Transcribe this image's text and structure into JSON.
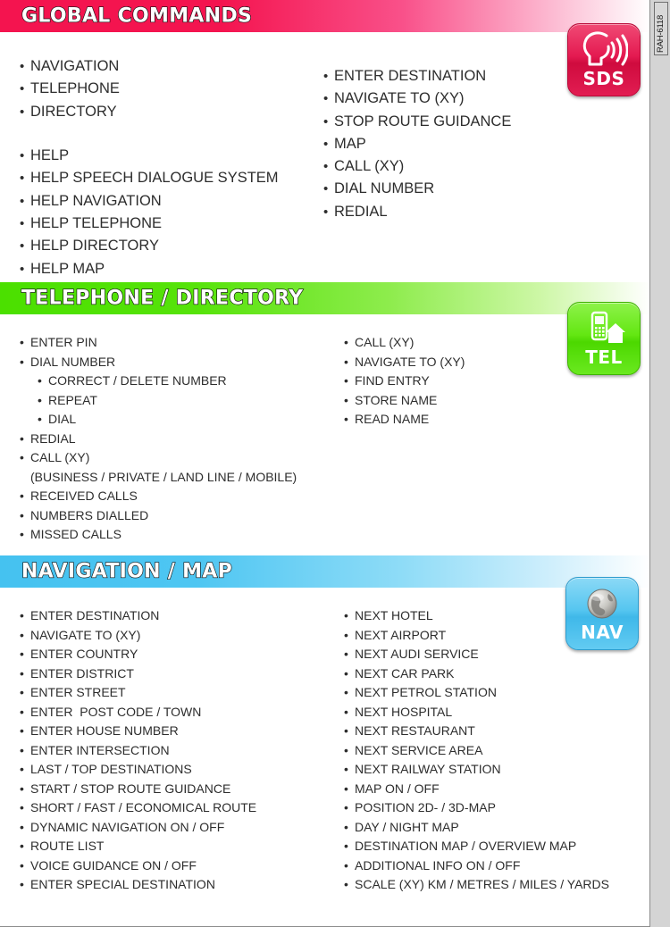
{
  "document": {
    "side_label": "RAH-6118"
  },
  "sections": [
    {
      "id": "global-commands",
      "title": "GLOBAL COMMANDS",
      "accent": "#f4144f",
      "icon": {
        "label": "SDS",
        "glyph": "speaking-head-icon"
      },
      "left_column": [
        {
          "text": "NAVIGATION",
          "level": 1
        },
        {
          "text": "TELEPHONE",
          "level": 1
        },
        {
          "text": "DIRECTORY",
          "level": 1
        },
        {
          "text": "",
          "level": 0
        },
        {
          "text": "HELP",
          "level": 1
        },
        {
          "text": "HELP SPEECH DIALOGUE SYSTEM",
          "level": 1
        },
        {
          "text": "HELP NAVIGATION",
          "level": 1
        },
        {
          "text": "HELP TELEPHONE",
          "level": 1
        },
        {
          "text": "HELP DIRECTORY",
          "level": 1
        },
        {
          "text": "HELP MAP",
          "level": 1
        }
      ],
      "right_column": [
        {
          "text": "ENTER DESTINATION",
          "level": 1
        },
        {
          "text": "NAVIGATE TO (XY)",
          "level": 1
        },
        {
          "text": "STOP ROUTE GUIDANCE",
          "level": 1
        },
        {
          "text": "MAP",
          "level": 1
        },
        {
          "text": "CALL (XY)",
          "level": 1
        },
        {
          "text": "DIAL NUMBER",
          "level": 1
        },
        {
          "text": "REDIAL",
          "level": 1
        }
      ]
    },
    {
      "id": "telephone-directory",
      "title": "TELEPHONE / DIRECTORY",
      "accent": "#4be000",
      "icon": {
        "label": "TEL",
        "glyph": "mobile-phone-house-icon"
      },
      "left_column": [
        {
          "text": "ENTER PIN",
          "level": 1
        },
        {
          "text": "DIAL NUMBER",
          "level": 1
        },
        {
          "text": "CORRECT / DELETE NUMBER",
          "level": 2
        },
        {
          "text": "REPEAT",
          "level": 2
        },
        {
          "text": "DIAL",
          "level": 2
        },
        {
          "text": "REDIAL",
          "level": 1
        },
        {
          "text": "CALL (XY)",
          "level": 1
        },
        {
          "text": "(BUSINESS / PRIVATE / LAND LINE / MOBILE)",
          "level": 0
        },
        {
          "text": "RECEIVED CALLS",
          "level": 1
        },
        {
          "text": "NUMBERS DIALLED",
          "level": 1
        },
        {
          "text": "MISSED CALLS",
          "level": 1
        }
      ],
      "right_column": [
        {
          "text": "CALL (XY)",
          "level": 1
        },
        {
          "text": "NAVIGATE TO (XY)",
          "level": 1
        },
        {
          "text": "FIND ENTRY",
          "level": 1
        },
        {
          "text": "STORE NAME",
          "level": 1
        },
        {
          "text": "READ NAME",
          "level": 1
        }
      ]
    },
    {
      "id": "navigation-map",
      "title": "NAVIGATION / MAP",
      "accent": "#45c2f0",
      "icon": {
        "label": "NAV",
        "glyph": "globe-icon"
      },
      "left_column": [
        {
          "text": "ENTER DESTINATION",
          "level": 1
        },
        {
          "text": "NAVIGATE TO (XY)",
          "level": 1
        },
        {
          "text": "ENTER COUNTRY",
          "level": 1
        },
        {
          "text": "ENTER DISTRICT",
          "level": 1
        },
        {
          "text": "ENTER STREET",
          "level": 1
        },
        {
          "text": "ENTER  POST CODE / TOWN",
          "level": 1
        },
        {
          "text": "ENTER HOUSE NUMBER",
          "level": 1
        },
        {
          "text": "ENTER INTERSECTION",
          "level": 1
        },
        {
          "text": "LAST / TOP DESTINATIONS",
          "level": 1
        },
        {
          "text": "START / STOP ROUTE GUIDANCE",
          "level": 1
        },
        {
          "text": "SHORT / FAST / ECONOMICAL ROUTE",
          "level": 1
        },
        {
          "text": "DYNAMIC NAVIGATION ON / OFF",
          "level": 1
        },
        {
          "text": "ROUTE LIST",
          "level": 1
        },
        {
          "text": "VOICE GUIDANCE ON / OFF",
          "level": 1
        },
        {
          "text": "ENTER SPECIAL DESTINATION",
          "level": 1
        }
      ],
      "right_column": [
        {
          "text": "NEXT HOTEL",
          "level": 1
        },
        {
          "text": "NEXT AIRPORT",
          "level": 1
        },
        {
          "text": "NEXT AUDI SERVICE",
          "level": 1
        },
        {
          "text": "NEXT CAR PARK",
          "level": 1
        },
        {
          "text": "NEXT PETROL STATION",
          "level": 1
        },
        {
          "text": "NEXT HOSPITAL",
          "level": 1
        },
        {
          "text": "NEXT RESTAURANT",
          "level": 1
        },
        {
          "text": "NEXT SERVICE AREA",
          "level": 1
        },
        {
          "text": "NEXT RAILWAY STATION",
          "level": 1
        },
        {
          "text": "MAP ON / OFF",
          "level": 1
        },
        {
          "text": "POSITION 2D- / 3D-MAP",
          "level": 1
        },
        {
          "text": "DAY / NIGHT MAP",
          "level": 1
        },
        {
          "text": "DESTINATION MAP / OVERVIEW MAP",
          "level": 1
        },
        {
          "text": "ADDITIONAL INFO ON / OFF",
          "level": 1
        },
        {
          "text": "SCALE (XY) KM / METRES / MILES / YARDS",
          "level": 1
        }
      ]
    }
  ],
  "bullet": "•"
}
